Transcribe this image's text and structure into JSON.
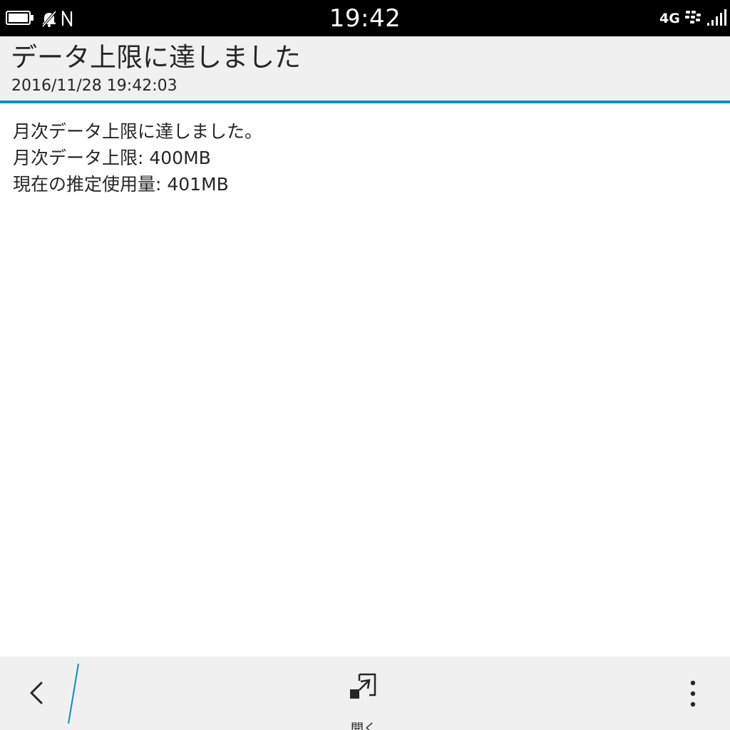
{
  "status_bar": {
    "time": "19:42",
    "network_type": "4G",
    "icons": [
      "battery-icon",
      "notifications-muted-icon",
      "nfc-icon",
      "blackberry-logo-icon",
      "signal-strength-icon"
    ]
  },
  "notification": {
    "title": "データ上限に達しました",
    "timestamp": "2016/11/28 19:42:03",
    "body_lines": [
      "月次データ上限に達しました。",
      "月次データ上限: 400MB",
      "現在の推定使用量: 401MB"
    ]
  },
  "action_bar": {
    "open_label": "開く",
    "icons": [
      "back-chevron-icon",
      "open-in-icon",
      "overflow-menu-icon"
    ]
  },
  "colors": {
    "accent": "#0e8bbe",
    "status_bar_bg": "#000000",
    "header_bg": "#f0f0f0",
    "action_bar_bg": "#f0f0f0",
    "text": "#262626"
  }
}
